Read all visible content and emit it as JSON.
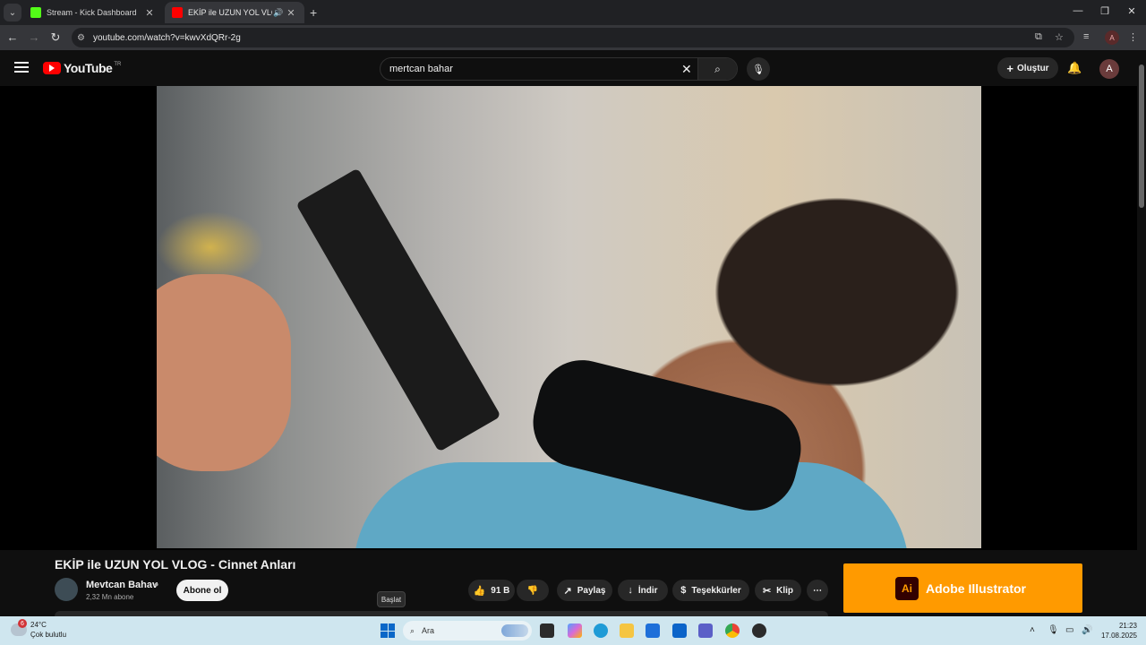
{
  "browser": {
    "tabs": [
      {
        "title": "Stream - Kick Dashboard",
        "favicon_color": "#53fc18"
      },
      {
        "title": "EKİP ile UZUN YOL VLOG - ",
        "favicon_color": "#ff0000"
      }
    ],
    "url": "youtube.com/watch?v=kwvXdQRr-2g",
    "profile_initial": "A"
  },
  "youtube": {
    "logo_text": "YouTube",
    "region": "TR",
    "search_value": "mertcan bahar",
    "create_label": "Oluştur",
    "avatar_initial": "A"
  },
  "video": {
    "title": "EKİP ile UZUN YOL VLOG - Cinnet Anları",
    "channel_name": "Mevtcan Bahav",
    "subscribers": "2,32 Mn abone",
    "subscribe_label": "Abone ol",
    "likes": "91 B",
    "share_label": "Paylaş",
    "download_label": "İndir",
    "thanks_label": "Teşekkürler",
    "clip_label": "Klip"
  },
  "overlay": {
    "ad_text": "Adobe Illustrator",
    "ad_logo": "Ai",
    "tooltip": "Başlat"
  },
  "taskbar": {
    "temperature": "24°C",
    "condition": "Çok bulutlu",
    "weather_badge": "6",
    "search_placeholder": "Ara",
    "time": "21:23",
    "date": "17.08.2025"
  }
}
